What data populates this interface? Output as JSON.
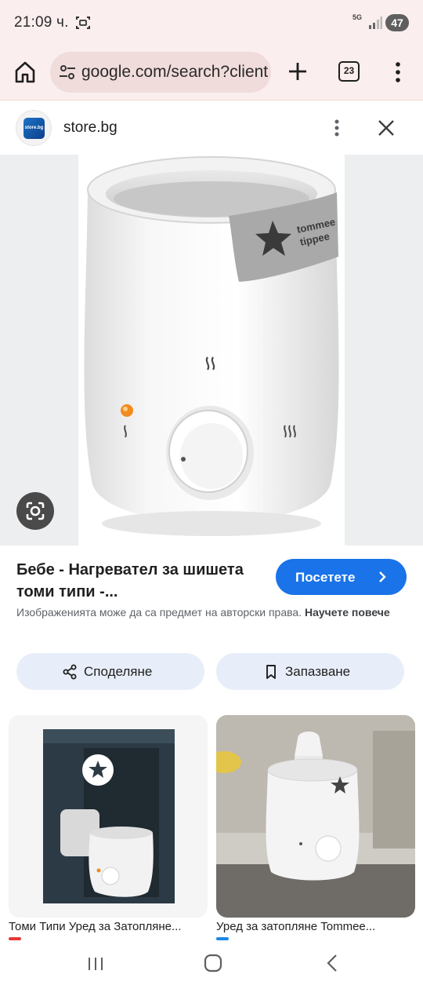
{
  "status_bar": {
    "time": "21:09 ч.",
    "network": "5G",
    "battery": "47"
  },
  "browser": {
    "url": "google.com/search?client",
    "tab_count": "23"
  },
  "source": {
    "logo_text": "store.bg",
    "name": "store.bg"
  },
  "result": {
    "title": "Бебе - Нагревател за шишета томи типи -...",
    "visit_label": "Посетете",
    "copyright_text": "Изображенията може да са предмет на авторски права.",
    "learn_more": "Научете повече"
  },
  "actions": {
    "share_label": "Споделяне",
    "save_label": "Запазване"
  },
  "related": [
    {
      "caption": "Томи Типи Уред за Затопляне...",
      "fav_color": "#e53935"
    },
    {
      "caption": "Уред за затопляне Tommee...",
      "fav_color": "#1e88e5"
    }
  ],
  "colors": {
    "browser_chrome": "#fbeeee",
    "accent": "#1a73e8",
    "action_button": "#e8eef9"
  },
  "icons": {
    "home": "home-icon",
    "tune": "tune-icon",
    "new_tab": "plus-icon",
    "menu": "more-vert-icon",
    "close": "close-icon",
    "lens": "google-lens-icon",
    "share": "share-icon",
    "save": "bookmark-icon"
  }
}
